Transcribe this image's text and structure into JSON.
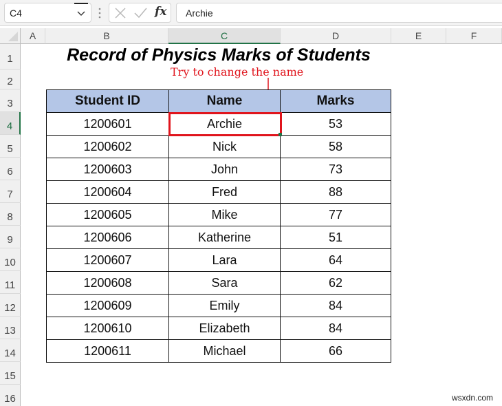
{
  "formula_bar": {
    "name_box": "C4",
    "cancel_icon": "x-icon",
    "enter_icon": "check-icon",
    "function_icon": "fx",
    "formula_value": "Archie"
  },
  "columns": [
    "A",
    "B",
    "C",
    "D",
    "E",
    "F"
  ],
  "selected_column": "C",
  "rows": [
    "1",
    "2",
    "3",
    "4",
    "5",
    "6",
    "7",
    "8",
    "9",
    "10",
    "11",
    "12",
    "13",
    "14",
    "15",
    "16"
  ],
  "selected_row": "4",
  "sheet": {
    "title": "Record of Physics Marks of Students",
    "annotation": "Try to change the name",
    "annotation_color": "#e0141c",
    "header_fill": "#b4c6e7",
    "headers": [
      "Student ID",
      "Name",
      "Marks"
    ],
    "records": [
      [
        "1200601",
        "Archie",
        "53"
      ],
      [
        "1200602",
        "Nick",
        "58"
      ],
      [
        "1200603",
        "John",
        "73"
      ],
      [
        "1200604",
        "Fred",
        "88"
      ],
      [
        "1200605",
        "Mike",
        "77"
      ],
      [
        "1200606",
        "Katherine",
        "51"
      ],
      [
        "1200607",
        "Lara",
        "64"
      ],
      [
        "1200608",
        "Sara",
        "62"
      ],
      [
        "1200609",
        "Emily",
        "84"
      ],
      [
        "1200610",
        "Elizabeth",
        "84"
      ],
      [
        "1200611",
        "Michael",
        "66"
      ]
    ]
  },
  "watermark": "wsxdn.com"
}
